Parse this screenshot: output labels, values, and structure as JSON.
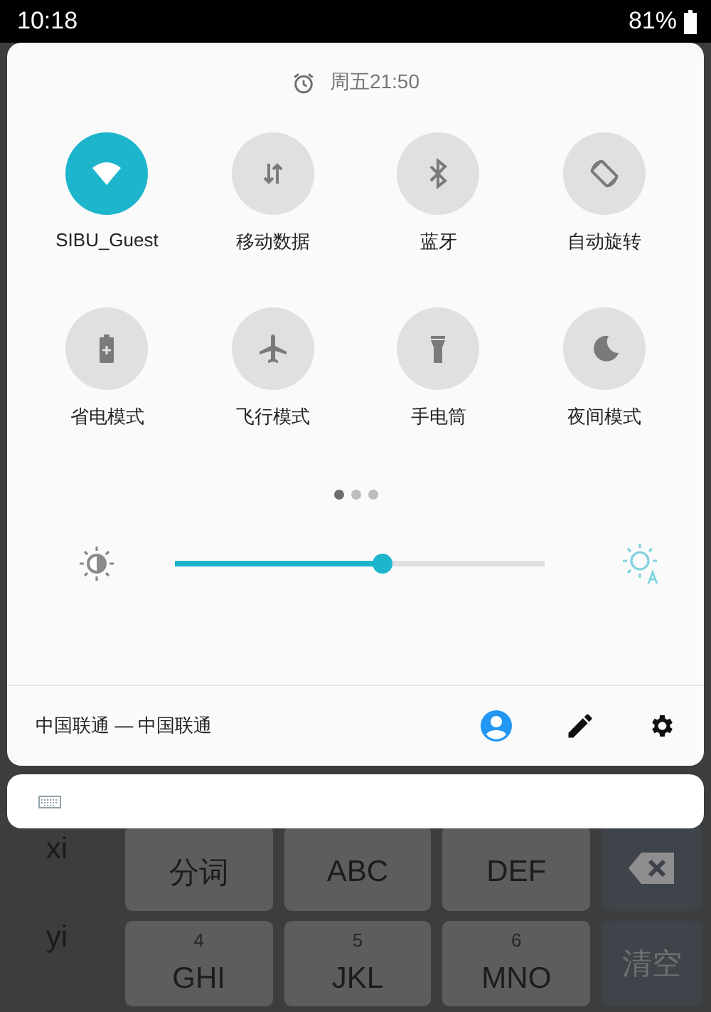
{
  "status_bar": {
    "time": "10:18",
    "battery": "81%"
  },
  "alarm": {
    "time": "周五21:50"
  },
  "tiles": [
    {
      "kind": "wifi",
      "label": "SIBU_Guest",
      "on": true
    },
    {
      "kind": "data",
      "label": "移动数据",
      "on": false
    },
    {
      "kind": "bluetooth",
      "label": "蓝牙",
      "on": false
    },
    {
      "kind": "rotate",
      "label": "自动旋转",
      "on": false
    },
    {
      "kind": "battery",
      "label": "省电模式",
      "on": false
    },
    {
      "kind": "airplane",
      "label": "飞行模式",
      "on": false
    },
    {
      "kind": "flashlight",
      "label": "手电筒",
      "on": false
    },
    {
      "kind": "night",
      "label": "夜间模式",
      "on": false
    }
  ],
  "pages": [
    {
      "selected": true
    },
    {
      "selected": false
    },
    {
      "selected": false
    }
  ],
  "brightness": {
    "level": 0.56,
    "auto": true
  },
  "carrier": "中国联通 — 中国联通",
  "keyboard": {
    "candidates": [
      "xi",
      "yi"
    ],
    "keys": [
      {
        "kind": "key",
        "label": "分词"
      },
      {
        "kind": "key",
        "label": "ABC"
      },
      {
        "kind": "key",
        "label": "DEF"
      },
      {
        "kind": "backspace"
      },
      {
        "kind": "key",
        "digit": "4",
        "label": "GHI"
      },
      {
        "kind": "key",
        "digit": "5",
        "label": "JKL"
      },
      {
        "kind": "key",
        "digit": "6",
        "label": "MNO"
      },
      {
        "kind": "function",
        "label": "清空"
      }
    ]
  }
}
